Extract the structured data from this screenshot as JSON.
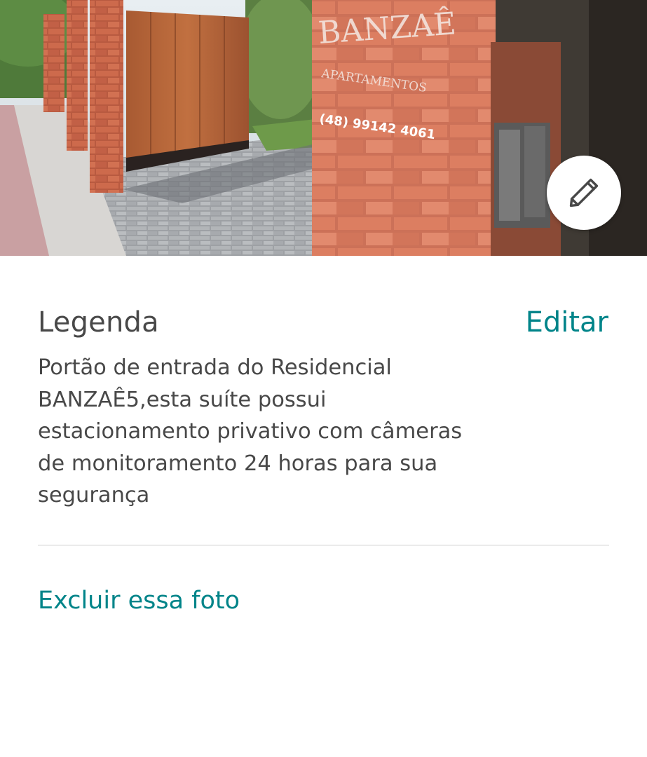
{
  "photo": {
    "sign_text": {
      "name": "BANZAÊ",
      "subtitle": "APARTAMENTOS",
      "phone": "(48) 99142 4061"
    },
    "edit_icon": "pencil-icon"
  },
  "caption": {
    "title": "Legenda",
    "edit_label": "Editar",
    "text": "Portão de entrada do Residencial\nBANZAÊ5,esta suíte possui\nestacionamento privativo com câmeras\nde monitoramento 24 horas para sua\nsegurança"
  },
  "actions": {
    "delete_label": "Excluir essa foto"
  },
  "colors": {
    "accent": "#008489",
    "text": "#484848",
    "divider": "#ebebeb"
  }
}
